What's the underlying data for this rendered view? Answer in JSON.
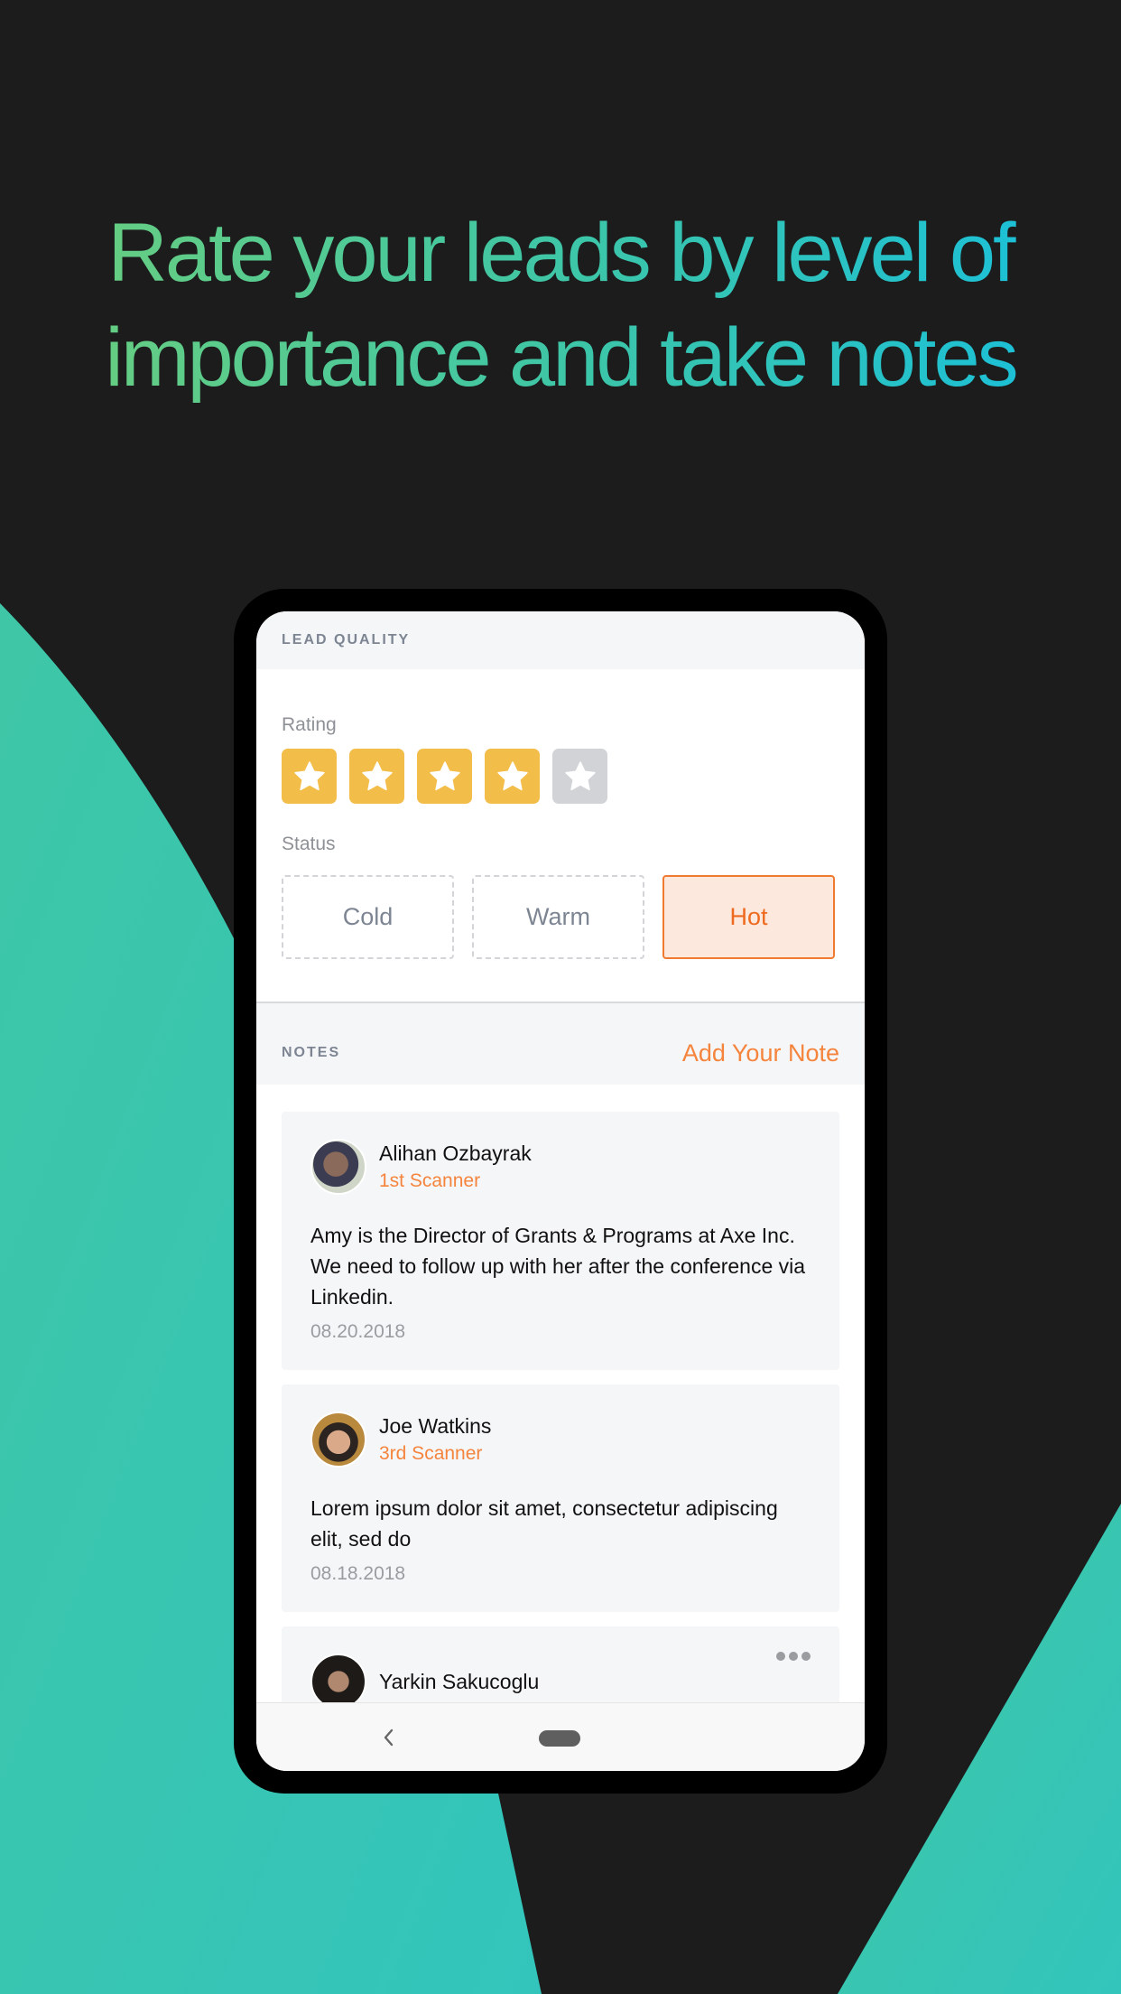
{
  "headline": {
    "line1": "Rate your leads by level of",
    "line2": "importance and take notes"
  },
  "colors": {
    "background": "#1c1c1c",
    "teal": "#3ec6a6",
    "headline_gradient_start": "#6ecf7b",
    "headline_gradient_end": "#16bfe0",
    "star_active": "#f3bd4a",
    "star_inactive": "#d1d3d7",
    "accent_orange": "#f5843d"
  },
  "lead_quality": {
    "section_title": "LEAD QUALITY",
    "rating_label": "Rating",
    "rating": {
      "value": 4,
      "max": 5
    },
    "status_label": "Status",
    "status_options": [
      {
        "label": "Cold",
        "selected": false
      },
      {
        "label": "Warm",
        "selected": false
      },
      {
        "label": "Hot",
        "selected": true
      }
    ]
  },
  "notes": {
    "section_title": "NOTES",
    "add_note_label": "Add Your Note",
    "items": [
      {
        "author": "Alihan Ozbayrak",
        "role": "1st Scanner",
        "text": "Amy is the Director of Grants & Programs at Axe Inc. We need to follow up with her after the conference via Linkedin.",
        "date": "08.20.2018"
      },
      {
        "author": "Joe Watkins",
        "role": "3rd Scanner",
        "text": "Lorem ipsum dolor sit amet, consectetur adipiscing elit, sed do",
        "date": "08.18.2018"
      },
      {
        "author": "Yarkin Sakucoglu",
        "more_icon": "more-horizontal-icon"
      }
    ]
  },
  "navbar": {
    "back_icon": "chevron-left-icon",
    "home_icon": "home-pill-icon"
  }
}
